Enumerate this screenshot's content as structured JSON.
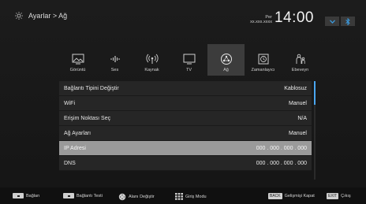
{
  "header": {
    "breadcrumb": "Ayarlar > Ağ",
    "clock": {
      "day": "Per",
      "date": "xx.xxx.xxxx",
      "time": "14:00"
    },
    "status": {
      "arrow_icon": "chevron-down-icon",
      "wireless_icon": "bluetooth-icon",
      "accent": "#3aa0e8"
    }
  },
  "menu": {
    "items": [
      {
        "label": "Görüntü",
        "icon": "picture-icon"
      },
      {
        "label": "Ses",
        "icon": "sound-icon"
      },
      {
        "label": "Kaynak",
        "icon": "source-icon"
      },
      {
        "label": "TV",
        "icon": "tv-icon"
      },
      {
        "label": "Ağ",
        "icon": "network-icon",
        "active": true
      },
      {
        "label": "Zamanlayıcı",
        "icon": "timer-icon"
      },
      {
        "label": "Ebeveyn",
        "icon": "parental-icon"
      }
    ]
  },
  "settings": {
    "rows": [
      {
        "label": "Bağlantı Tipini Değiştir",
        "value": "Kablosuz"
      },
      {
        "label": "WiFi",
        "value": "Manuel"
      },
      {
        "label": "Erişim Noktası Seç",
        "value": "N/A"
      },
      {
        "label": "Ağ Ayarları",
        "value": "Manuel"
      },
      {
        "label": "IP Adresi",
        "value": "000 . 000 . 000 . 000",
        "selected": true
      },
      {
        "label": "DNS",
        "value": "000 . 000 . 000 . 000"
      }
    ]
  },
  "footer": {
    "connect": "Bağlan",
    "connection_test": "Bağlantı Testi",
    "change_field": "Alanı Değiştir",
    "input_mode": "Giriş Modu",
    "back_key": "BACK",
    "back_label": "Gelişmişi Kapat",
    "exit_key": "EXIT",
    "exit_label": "Çıkış"
  }
}
